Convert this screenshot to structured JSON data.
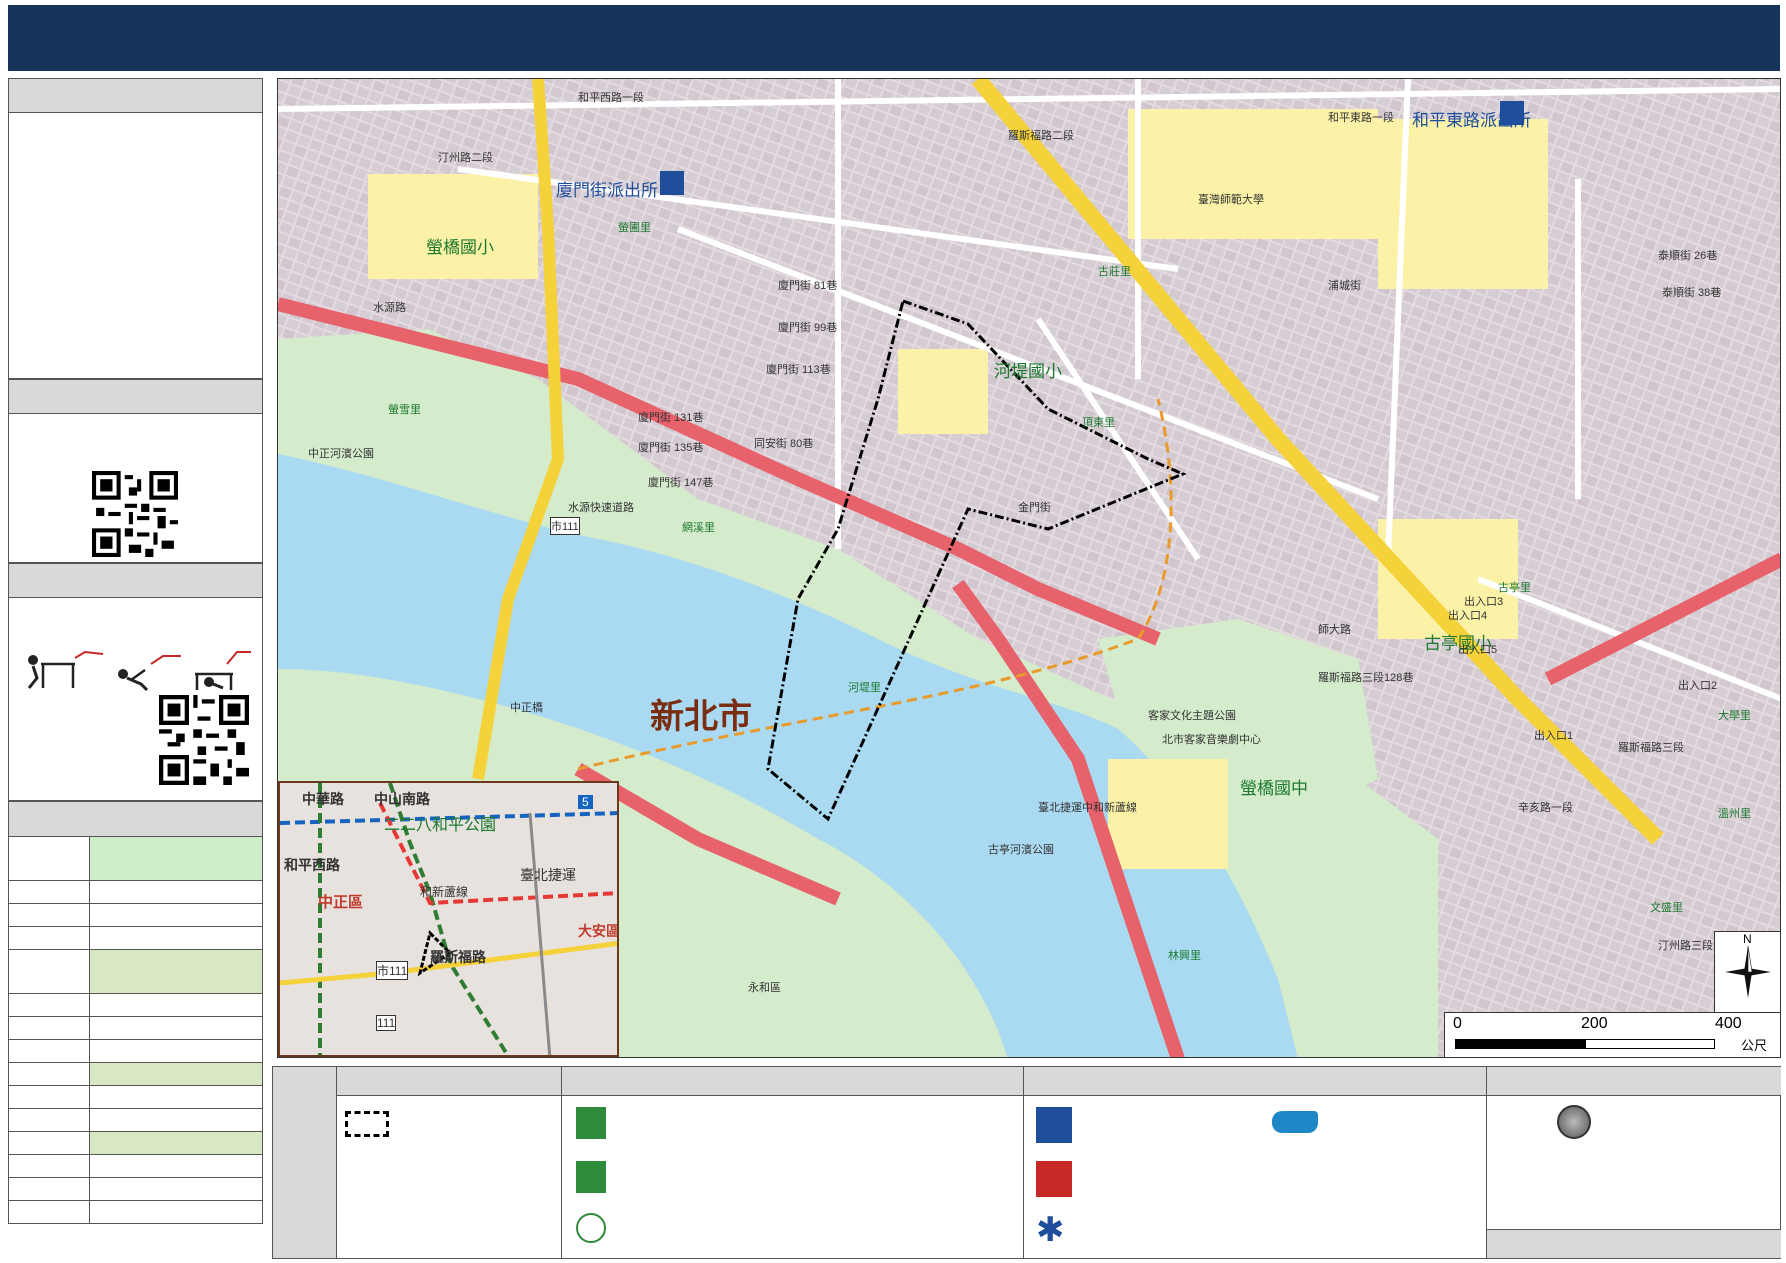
{
  "map": {
    "city": "新北市",
    "districts": [
      "中正區",
      "大安區"
    ],
    "schools": [
      {
        "name": "螢橋國小"
      },
      {
        "name": "河堤國小"
      },
      {
        "name": "古亭國小"
      },
      {
        "name": "螢橋國中"
      }
    ],
    "police": [
      {
        "name": "廈門街派出所"
      },
      {
        "name": "和平東路派出所"
      }
    ],
    "small_labels": {
      "l1": "汀州路二段",
      "l2": "水源路",
      "l3": "水源快速道路",
      "l4": "廈門街 81巷",
      "l5": "廈門街 99巷",
      "l6": "廈門街 113巷",
      "l7": "廈門街 131巷",
      "l8": "廈門街 135巷",
      "l9": "廈門街 147巷",
      "l10": "同安街 80巷",
      "l11": "羅斯福路二段",
      "l12": "羅斯福路三段128巷",
      "l13": "師大路",
      "l14": "泰順街 26巷",
      "l15": "泰順街 38巷",
      "l16": "浦城街",
      "l17": "中正河濱公園",
      "l18": "客家文化主題公園",
      "l19": "北市客家音樂劇中心",
      "l20": "古亭河濱公園",
      "l21": "臺北捷運中和新蘆線",
      "l22": "河堤里",
      "l23": "螢雪里",
      "l24": "林興里",
      "l25": "臺灣師範大學",
      "l26": "市111",
      "l27": "中正橋",
      "l28": "螢圃里",
      "l29": "網溪里",
      "l30": "頂東里",
      "l31": "古莊里",
      "l32": "古亭里",
      "l33": "文盛里",
      "l34": "大學里",
      "l35": "溫州里",
      "l36": "永和區",
      "l37": "出入口2",
      "l38": "出入口3",
      "l39": "出入口4",
      "l40": "出入口5",
      "l41": "出入口1",
      "l42": "和平東路一段",
      "l43": "和平西路一段",
      "l44": "羅斯福路三段",
      "l45": "金門街",
      "l46": "汀州路三段",
      "l47": "辛亥路一段"
    },
    "inset": {
      "labels": {
        "a": "中華路",
        "b": "中山南路",
        "c": "二二八和平公園",
        "d": "和平西路",
        "e": "中正區",
        "f": "大安區",
        "g": "臺北捷運",
        "h": "羅斯福路",
        "i": "市111",
        "j": "111",
        "k": "和新蘆線",
        "m": "5"
      }
    },
    "scale": {
      "tick0": "0",
      "tick1": "200",
      "tick2": "400",
      "unit": "公尺"
    },
    "north": "N"
  },
  "colors": {
    "title_bar": "#14345a",
    "major_road": "#e8626b",
    "highway": "#f5d13a",
    "river": "#aadaf2",
    "park": "#d4ebcc",
    "school_area": "#fbf2a8"
  }
}
